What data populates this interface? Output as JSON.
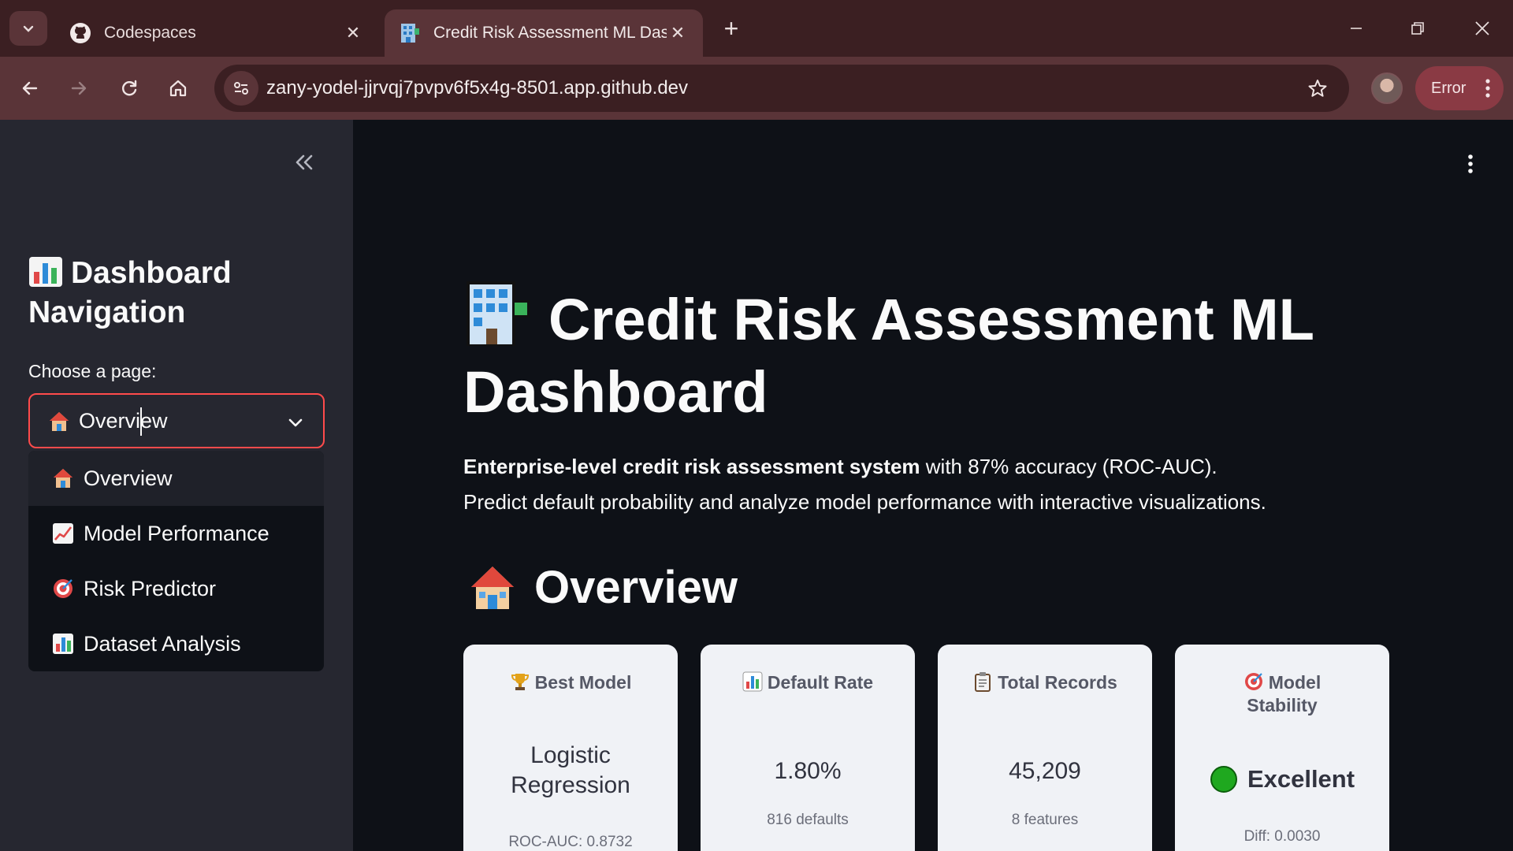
{
  "browser": {
    "tabs": [
      {
        "title": "Codespaces",
        "icon": "github-icon",
        "active": false
      },
      {
        "title": "Credit Risk Assessment ML Dashboard",
        "icon": "office-building-icon",
        "active": true
      }
    ],
    "url": "zany-yodel-jjrvqj7pvpv6f5x4g-8501.app.github.dev",
    "error_label": "Error",
    "accent_color": "#5a3438"
  },
  "sidebar": {
    "title": "Dashboard Navigation",
    "select_label": "Choose a page:",
    "selected_value": "Overview",
    "options": [
      {
        "label": "Overview",
        "icon": "house-icon"
      },
      {
        "label": "Model Performance",
        "icon": "chart-increasing-icon"
      },
      {
        "label": "Risk Predictor",
        "icon": "target-icon"
      },
      {
        "label": "Dataset Analysis",
        "icon": "bar-chart-icon"
      }
    ]
  },
  "main": {
    "title": "Credit Risk Assessment ML Dashboard",
    "intro_bold": "Enterprise-level credit risk assessment system",
    "intro_rest": " with 87% accuracy (ROC-AUC).",
    "intro_line2": "Predict default probability and analyze model performance with interactive visualizations.",
    "section_heading": "Overview",
    "metrics": [
      {
        "label": "Best Model",
        "icon": "trophy-icon",
        "value": "Logistic Regression",
        "sub": "ROC-AUC: 0.8732"
      },
      {
        "label": "Default Rate",
        "icon": "bar-chart-icon",
        "value": "1.80%",
        "sub": "816 defaults"
      },
      {
        "label": "Total Records",
        "icon": "clipboard-icon",
        "value": "45,209",
        "sub": "8 features"
      },
      {
        "label": "Model Stability",
        "icon": "target-icon",
        "value": "Excellent",
        "status_icon": "green-circle-icon",
        "sub": "Diff: 0.0030"
      }
    ]
  }
}
